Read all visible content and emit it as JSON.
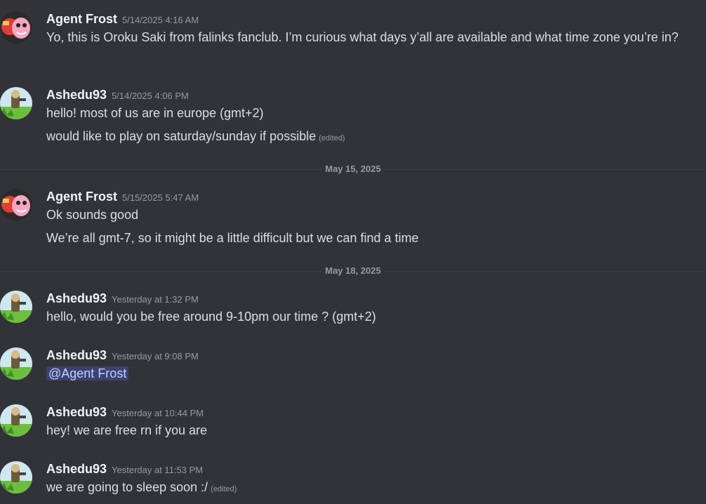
{
  "messages": [
    {
      "author": "Agent Frost",
      "avatar": "pink-character-avatar",
      "timestamp": "5/14/2025 4:16 AM",
      "lines": [
        "Yo, this is Oroku Saki from falinks fanclub. I’m curious what days y’all are available and what time zone you’re in?"
      ]
    },
    {
      "author": "Ashedu93",
      "avatar": "grass-character-avatar",
      "timestamp": "5/14/2025 4:06 PM",
      "lines": [
        "hello! most of us are in europe (gmt+2)",
        "would like to play on saturday/sunday if possible"
      ],
      "edited_label": "(edited)"
    },
    {
      "author": "Agent Frost",
      "avatar": "pink-character-avatar",
      "timestamp": "5/15/2025 5:47 AM",
      "lines": [
        "Ok sounds good",
        "We’re all gmt-7, so it might be a little difficult but we can find a time"
      ]
    },
    {
      "author": "Ashedu93",
      "avatar": "grass-character-avatar",
      "timestamp": "Yesterday at 1:32 PM",
      "lines": [
        "hello, would you be free around 9-10pm our time ? (gmt+2)"
      ]
    },
    {
      "author": "Ashedu93",
      "avatar": "grass-character-avatar",
      "timestamp": "Yesterday at 9:08 PM",
      "mention": "@Agent Frost"
    },
    {
      "author": "Ashedu93",
      "avatar": "grass-character-avatar",
      "timestamp": "Yesterday at 10:44 PM",
      "lines": [
        "hey! we are free rn if you are"
      ]
    },
    {
      "author": "Ashedu93",
      "avatar": "grass-character-avatar",
      "timestamp": "Yesterday at 11:53 PM",
      "lines": [
        "we are going to sleep soon :/"
      ],
      "edited_label": "(edited)"
    }
  ],
  "dividers": [
    "May 15, 2025",
    "May 18, 2025"
  ],
  "colors": {
    "background": "#323339",
    "username": "#f2f3f5",
    "text": "#dbdee1",
    "muted": "#949ba4",
    "mention_bg": "#3c4270",
    "mention_text": "#c9cdfb"
  }
}
